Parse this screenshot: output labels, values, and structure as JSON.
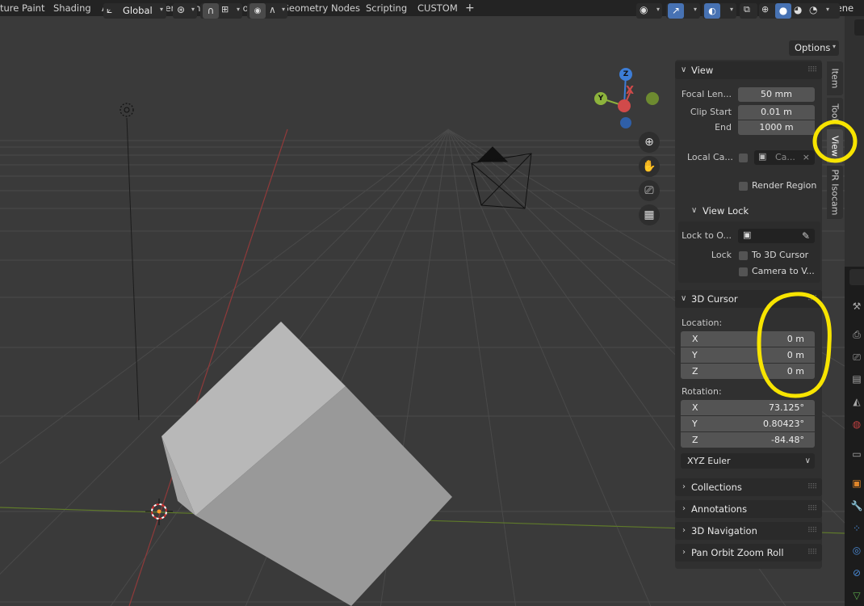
{
  "workspace_tabs": [
    "ture Paint",
    "Shading",
    "Animation",
    "Rendering",
    "Compositing",
    "Geometry Nodes",
    "Scripting",
    "CUSTOM"
  ],
  "add_workspace": "+",
  "scene_name": "Scene",
  "header": {
    "transform_orientation": "Global",
    "options_label": "Options"
  },
  "gizmo": {
    "x": "X",
    "y": "Y",
    "z": "Z"
  },
  "npanel": {
    "view": {
      "title": "View",
      "focal_label": "Focal Len...",
      "focal_value": "50 mm",
      "clip_start_label": "Clip Start",
      "clip_start_value": "0.01 m",
      "end_label": "End",
      "end_value": "1000 m",
      "local_camera_label": "Local Ca...",
      "local_camera_value": "Ca...",
      "render_region_label": "Render Region"
    },
    "view_lock": {
      "title": "View Lock",
      "lock_to_label": "Lock to O...",
      "lock_label": "Lock",
      "to_cursor_label": "To 3D Cursor",
      "camera_to_view_label": "Camera to V..."
    },
    "cursor": {
      "title": "3D Cursor",
      "location_label": "Location:",
      "location": [
        {
          "axis": "X",
          "value": "0 m"
        },
        {
          "axis": "Y",
          "value": "0 m"
        },
        {
          "axis": "Z",
          "value": "0 m"
        }
      ],
      "rotation_label": "Rotation:",
      "rotation": [
        {
          "axis": "X",
          "value": "73.125°"
        },
        {
          "axis": "Y",
          "value": "0.80423°"
        },
        {
          "axis": "Z",
          "value": "-84.48°"
        }
      ],
      "rotation_mode": "XYZ Euler"
    },
    "collapsed_sections": [
      "Collections",
      "Annotations",
      "3D Navigation",
      "Pan Orbit Zoom Roll"
    ]
  },
  "sidebar_tabs": [
    "Item",
    "Tool",
    "View",
    "PR Isocam"
  ],
  "colors": {
    "x_axis": "#d14a4a",
    "y_axis": "#8db33c",
    "z_axis": "#3d7dd6",
    "highlight": "#f7e400",
    "active_toggle": "#4772b3"
  }
}
